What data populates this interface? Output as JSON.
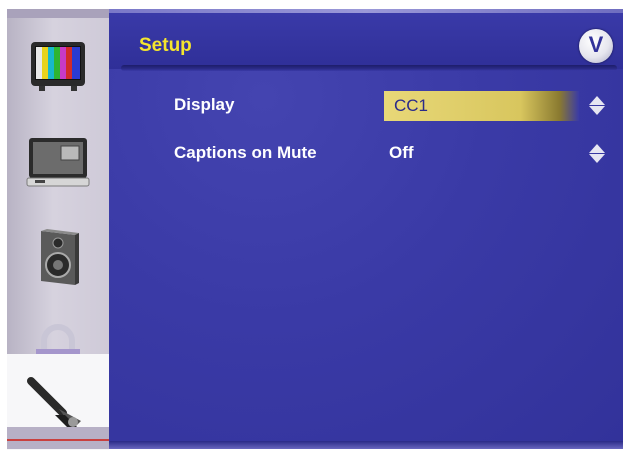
{
  "menu": {
    "title": "Setup",
    "logo_letter": "V"
  },
  "sidebar": {
    "items": [
      {
        "name": "picture",
        "icon": "tv-color-bars-icon",
        "selected": false
      },
      {
        "name": "pip",
        "icon": "monitor-pip-icon",
        "selected": false
      },
      {
        "name": "audio",
        "icon": "speaker-icon",
        "selected": false
      },
      {
        "name": "parental",
        "icon": "lock-icon",
        "selected": false
      },
      {
        "name": "setup",
        "icon": "wrench-icon",
        "selected": true
      }
    ]
  },
  "settings": [
    {
      "label": "Display",
      "value": "CC1",
      "highlighted": true
    },
    {
      "label": "Captions on Mute",
      "value": "Off",
      "highlighted": false
    }
  ],
  "colors": {
    "panel_bg": "#3a3aa6",
    "title": "#f4e52e",
    "highlight": "#e0d06a",
    "text": "#ffffff"
  }
}
